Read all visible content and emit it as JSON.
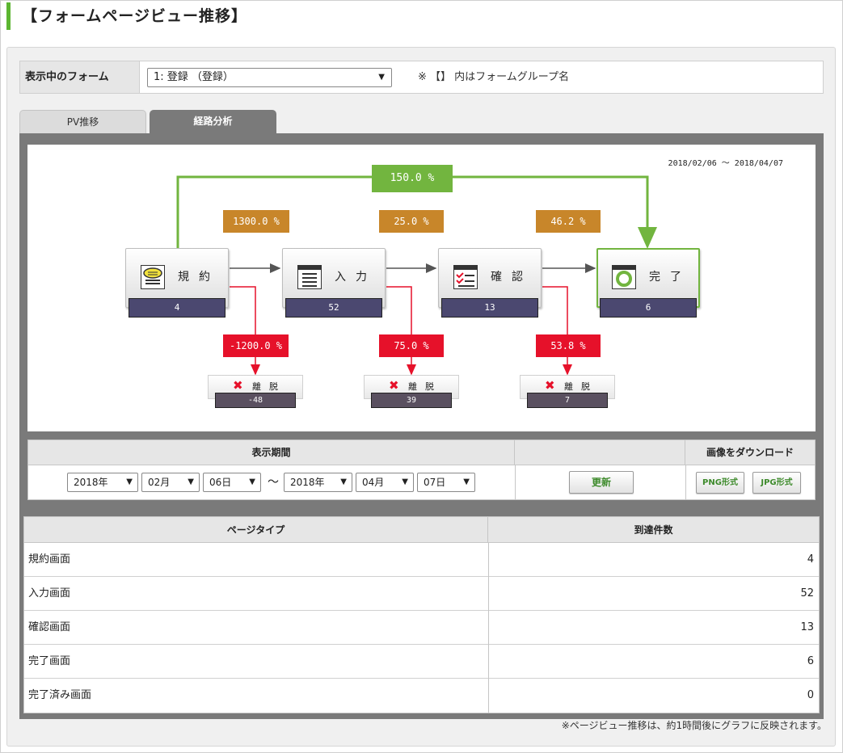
{
  "page": {
    "title": "【フォームページビュー推移】"
  },
  "form_selector": {
    "label": "表示中のフォーム",
    "selected": "1: 登録 （登録）",
    "note": "※ 【】 内はフォームグループ名"
  },
  "tabs": [
    {
      "label": "PV推移",
      "active": false
    },
    {
      "label": "経路分析",
      "active": true
    }
  ],
  "diagram": {
    "date_range": "2018/02/06 ～ 2018/04/07",
    "overall_rate": "150.0 %",
    "transition_rates": [
      "1300.0 %",
      "25.0 %",
      "46.2 %"
    ],
    "steps": [
      {
        "label": "規約",
        "count": "4",
        "icon": "terms-icon"
      },
      {
        "label": "入力",
        "count": "52",
        "icon": "input-icon"
      },
      {
        "label": "確認",
        "count": "13",
        "icon": "confirm-icon"
      },
      {
        "label": "完了",
        "count": "6",
        "icon": "complete-icon"
      }
    ],
    "exits": [
      {
        "rate": "-1200.0 %",
        "label": "離脱",
        "count": "-48"
      },
      {
        "rate": "75.0 %",
        "label": "離脱",
        "count": "39"
      },
      {
        "rate": "53.8 %",
        "label": "離脱",
        "count": "7"
      }
    ],
    "colors": {
      "green": "#72b53f",
      "orange": "#c8862a",
      "red": "#e6112a",
      "count_bg": "#4b4870"
    }
  },
  "period": {
    "header": "表示期間",
    "download_header": "画像をダウンロード",
    "tilde": "～",
    "from": {
      "year": "2018年",
      "month": "02月",
      "day": "06日"
    },
    "to": {
      "year": "2018年",
      "month": "04月",
      "day": "07日"
    },
    "update_label": "更新",
    "png_label": "PNG形式",
    "jpg_label": "JPG形式"
  },
  "stats": {
    "headers": [
      "ページタイプ",
      "到達件数"
    ],
    "rows": [
      {
        "name": "規約画面",
        "value": "4"
      },
      {
        "name": "入力画面",
        "value": "52"
      },
      {
        "name": "確認画面",
        "value": "13"
      },
      {
        "name": "完了画面",
        "value": "6"
      },
      {
        "name": "完了済み画面",
        "value": "0"
      }
    ]
  },
  "footnote": "※ページビュー推移は、約1時間後にグラフに反映されます。"
}
